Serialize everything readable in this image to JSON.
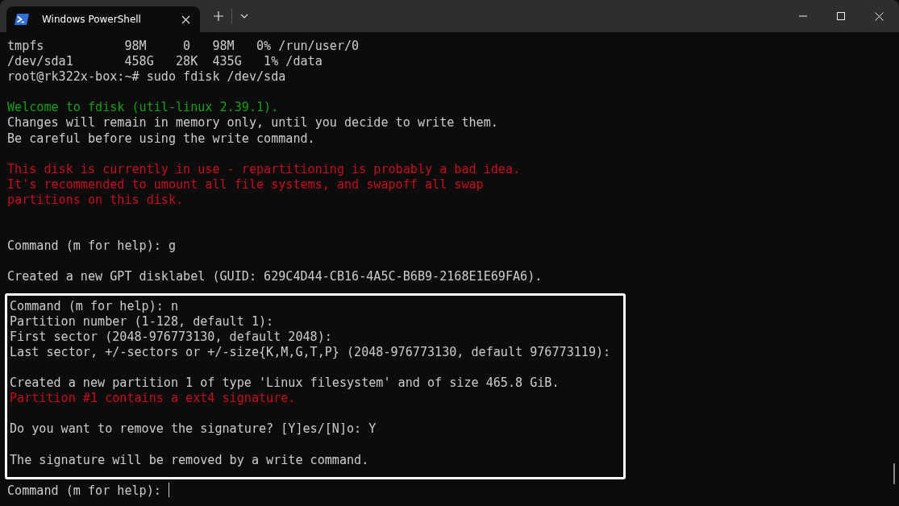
{
  "window": {
    "tab": {
      "title": "Windows PowerShell",
      "selected": true
    }
  },
  "terminal": {
    "blocks": [
      {
        "highlighted": false,
        "lines": [
          {
            "kind": "output",
            "text": "tmpfs           98M     0   98M   0% /run/user/0"
          },
          {
            "kind": "output",
            "text": "/dev/sda1       458G   28K  435G   1% /data"
          },
          {
            "kind": "output",
            "text": "root@rk322x-box:~# sudo fdisk /dev/sda"
          },
          {
            "kind": "blank"
          },
          {
            "kind": "success",
            "text": "Welcome to fdisk (util-linux 2.39.1)."
          },
          {
            "kind": "output",
            "text": "Changes will remain in memory only, until you decide to write them."
          },
          {
            "kind": "output",
            "text": "Be careful before using the write command."
          },
          {
            "kind": "blank"
          },
          {
            "kind": "error",
            "text": "This disk is currently in use - repartitioning is probably a bad idea."
          },
          {
            "kind": "error",
            "text": "It's recommended to umount all file systems, and swapoff all swap"
          },
          {
            "kind": "error",
            "text": "partitions on this disk."
          },
          {
            "kind": "blank"
          },
          {
            "kind": "blank"
          },
          {
            "kind": "output",
            "text": "Command (m for help): g"
          },
          {
            "kind": "blank"
          },
          {
            "kind": "output",
            "text": "Created a new GPT disklabel (GUID: 629C4D44-CB16-4A5C-B6B9-2168E1E69FA6)."
          },
          {
            "kind": "blank"
          }
        ]
      },
      {
        "highlighted": true,
        "lines": [
          {
            "kind": "output",
            "text": "Command (m for help): n"
          },
          {
            "kind": "output",
            "text": "Partition number (1-128, default 1):"
          },
          {
            "kind": "output",
            "text": "First sector (2048-976773130, default 2048):"
          },
          {
            "kind": "output",
            "text": "Last sector, +/-sectors or +/-size{K,M,G,T,P} (2048-976773130, default 976773119):"
          },
          {
            "kind": "blank"
          },
          {
            "kind": "output",
            "text": "Created a new partition 1 of type 'Linux filesystem' and of size 465.8 GiB."
          },
          {
            "kind": "error",
            "text": "Partition #1 contains a ext4 signature."
          },
          {
            "kind": "blank"
          },
          {
            "kind": "output",
            "text": "Do you want to remove the signature? [Y]es/[N]o: Y"
          },
          {
            "kind": "blank"
          },
          {
            "kind": "output",
            "text": "The signature will be removed by a write command."
          }
        ]
      },
      {
        "highlighted": false,
        "lines": [
          {
            "kind": "prompt",
            "text": "Command (m for help): "
          }
        ]
      }
    ]
  }
}
